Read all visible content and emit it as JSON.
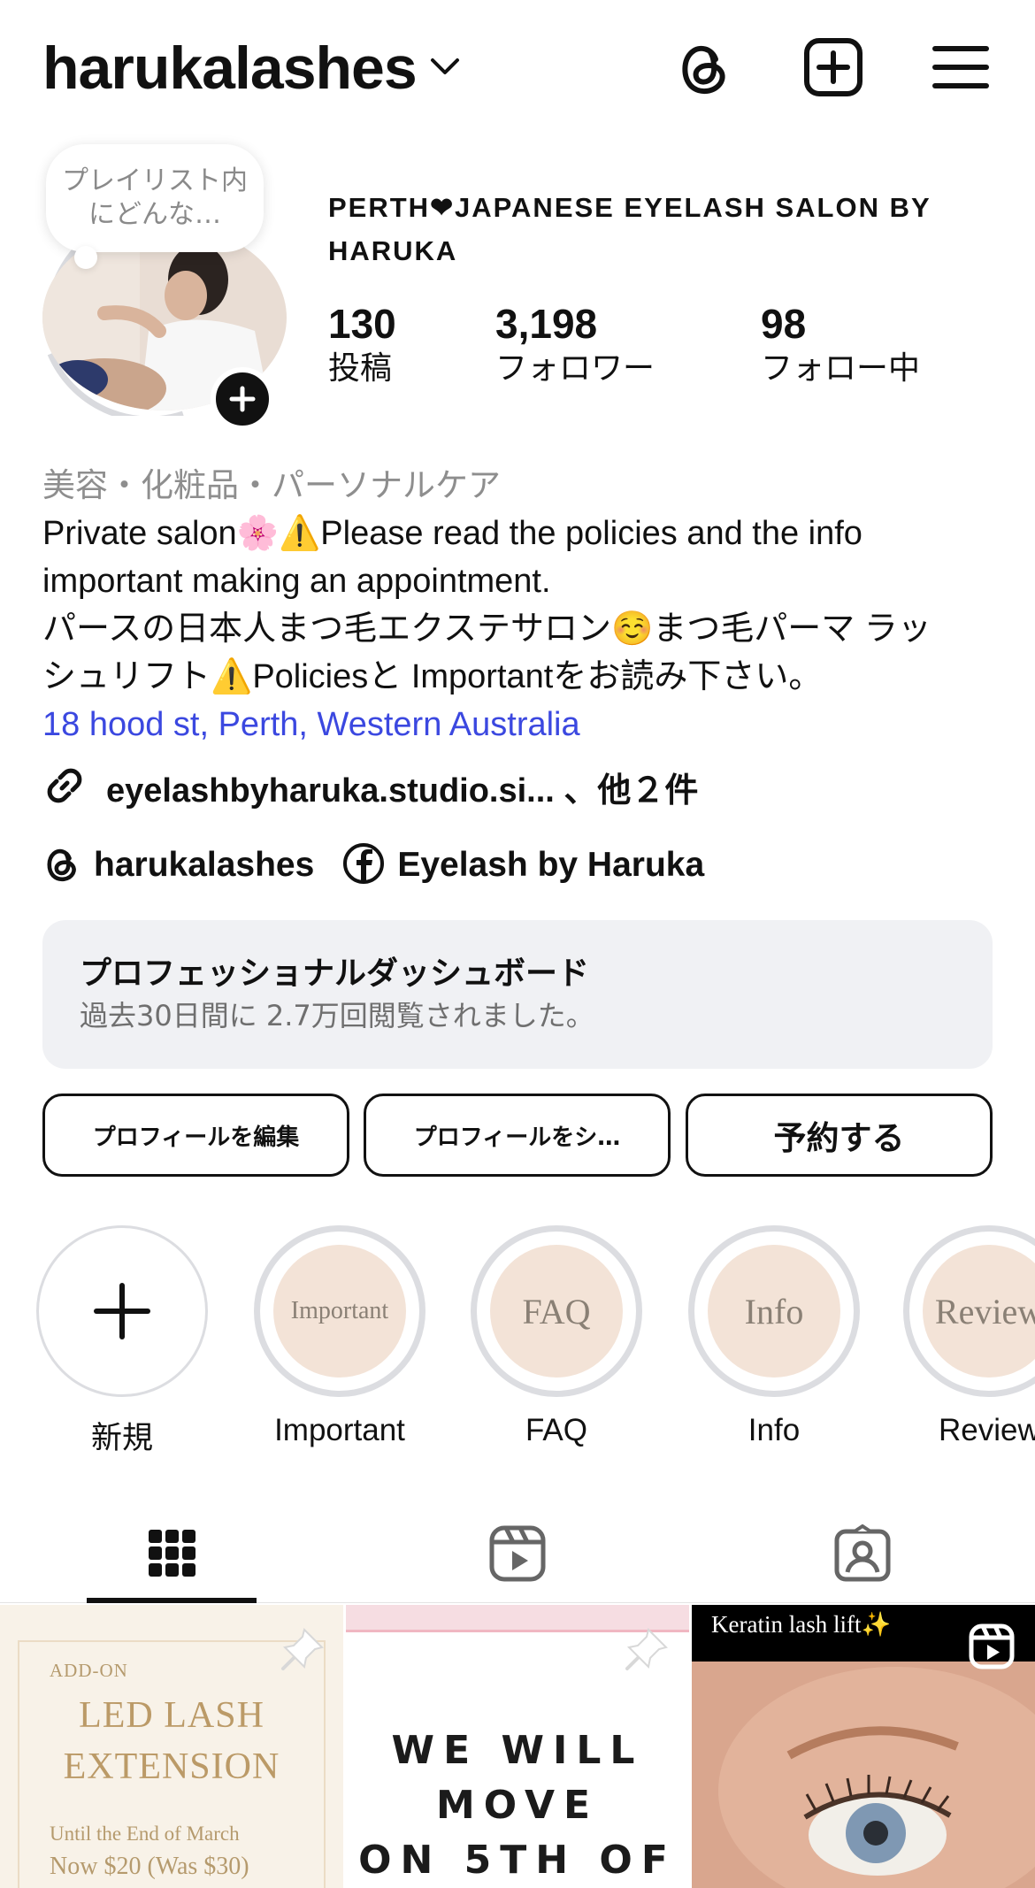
{
  "header": {
    "username": "harukalashes",
    "icons": [
      "chevron-down-icon",
      "threads-icon",
      "new-post-icon",
      "menu-icon"
    ]
  },
  "profile": {
    "note": "プレイリスト内にどんな…",
    "display_name": "PERTH❤JAPANESE EYELASH SALON BY HARUKA",
    "stats": [
      {
        "value": "130",
        "label": "投稿"
      },
      {
        "value": "3,198",
        "label": "フォロワー"
      },
      {
        "value": "98",
        "label": "フォロー中"
      }
    ]
  },
  "bio": {
    "category": "美容・化粧品・パーソナルケア",
    "lines": [
      "Private salon🌸⚠️Please read the policies and the info",
      "important making an appointment.",
      "パースの日本人まつ毛エクステサロン☺️まつ毛パーマ ラッ",
      "シュリフト⚠️Policiesと Importantをお読み下さい。"
    ],
    "address": "18 hood st, Perth, Western Australia",
    "link": "eyelashbyharuka.studio.si... 、他２件",
    "threads": "harukalashes",
    "facebook": "Eyelash by Haruka"
  },
  "dashboard": {
    "title": "プロフェッショナルダッシュボード",
    "subtitle": "過去30日間に 2.7万回閲覧されました。"
  },
  "buttons": {
    "edit": "プロフィールを編集",
    "share": "プロフィールをシ…",
    "book": "予約する"
  },
  "highlights": [
    {
      "label": "新規",
      "cover": ""
    },
    {
      "label": "Important",
      "cover": "Important"
    },
    {
      "label": "FAQ",
      "cover": "FAQ"
    },
    {
      "label": "Info",
      "cover": "Info"
    },
    {
      "label": "Review",
      "cover": "Review"
    }
  ],
  "tabs": [
    "grid-icon",
    "reels-icon",
    "tagged-icon"
  ],
  "posts": {
    "tile1": {
      "addon": "ADD-ON",
      "title_line1": "LED LASH",
      "title_line2": "EXTENSION",
      "until": "Until the End of March",
      "price": "Now $20 (Was $30)"
    },
    "tile2": {
      "line1": "WE WILL",
      "line2": "MOVE",
      "line3": "ON 5TH OF"
    },
    "tile3": {
      "caption": "Keratin lash lift✨"
    }
  },
  "colors": {
    "link_blue": "#3b48e0",
    "secondary_text": "#8e8e8e",
    "dashboard_bg": "#f0f1f4",
    "highlight_cover": "#f3e3d7"
  }
}
